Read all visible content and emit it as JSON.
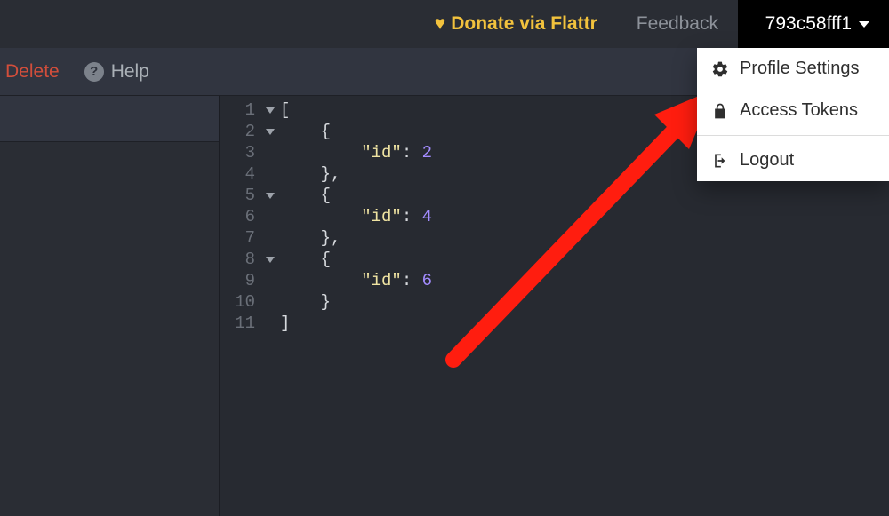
{
  "topbar": {
    "donate_label": "Donate via Flattr",
    "feedback_label": "Feedback",
    "user_label": "793c58fff1"
  },
  "toolbar": {
    "delete_label": "Delete",
    "help_label": "Help"
  },
  "dropdown": {
    "profile_label": "Profile Settings",
    "tokens_label": "Access Tokens",
    "logout_label": "Logout"
  },
  "editor": {
    "lines": {
      "l1": "1",
      "l2": "2",
      "l3": "3",
      "l4": "4",
      "l5": "5",
      "l6": "6",
      "l7": "7",
      "l8": "8",
      "l9": "9",
      "l10": "10",
      "l11": "11"
    },
    "code": {
      "open_bracket": "[",
      "open_brace": "{",
      "key_id": "\"id\"",
      "colon_sp": ": ",
      "v2": "2",
      "v4": "4",
      "v6": "6",
      "close_brace_comma": "},",
      "close_brace": "}",
      "close_bracket": "]"
    }
  }
}
